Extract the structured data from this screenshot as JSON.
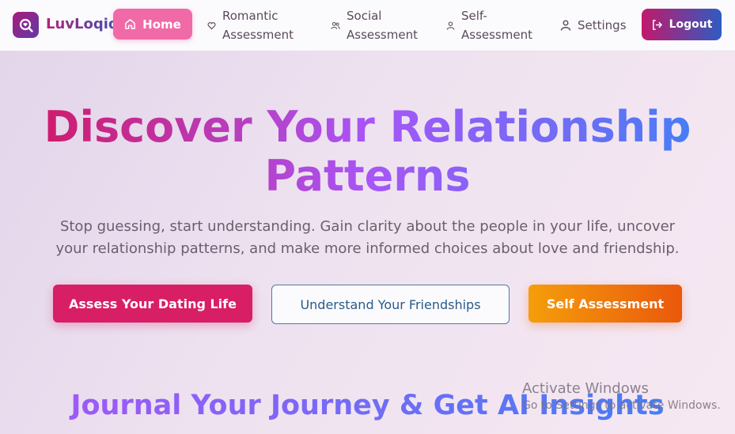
{
  "nav": {
    "brand": "LuvLoqiq",
    "home": "Home",
    "romantic": "Romantic Assessment",
    "social": "Social Assessment",
    "self": "Self-Assessment",
    "settings": "Settings",
    "logout": "Logout"
  },
  "hero": {
    "title_line1": "Discover Your Relationship",
    "title_line2": "Patterns",
    "subtitle": "Stop guessing, start understanding. Gain clarity about the people in your life, uncover your relationship patterns, and make more informed choices about love and friendship.",
    "btn_dating": "Assess Your Dating Life",
    "btn_friendships": "Understand Your Friendships",
    "btn_self": "Self Assessment"
  },
  "journal": {
    "heading": "Journal Your Journey & Get AI Insights"
  },
  "windows": {
    "title": "Activate Windows",
    "subtitle": "Go to Settings to activate Windows."
  },
  "colors": {
    "accent_pink": "#f06aa8",
    "primary": "#d81e64",
    "orange": "#ea580c",
    "blue": "#3b82f6",
    "purple": "#a855f7"
  }
}
